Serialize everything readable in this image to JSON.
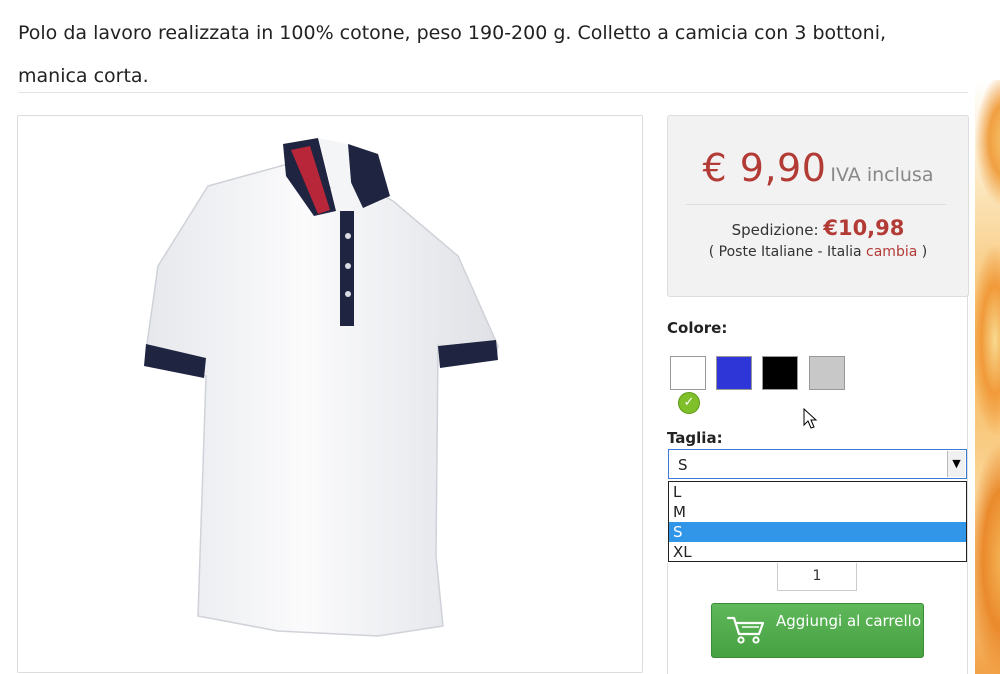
{
  "product": {
    "description": "Polo da lavoro realizzata in 100% cotone, peso 190-200 g. Colletto a camicia con 3 bottoni, manica corta."
  },
  "pricing": {
    "price": "€ 9,90",
    "vat_note": "IVA inclusa",
    "shipping_label": "Spedizione:",
    "shipping_value": "€10,98",
    "carrier_prefix": "( Poste Italiane - Italia",
    "change_link": "cambia",
    "carrier_suffix": ")"
  },
  "color": {
    "label": "Colore:",
    "swatches": [
      {
        "name": "white",
        "hex": "#ffffff",
        "selected": true
      },
      {
        "name": "royal-blue",
        "hex": "#2f36d8",
        "selected": false
      },
      {
        "name": "black",
        "hex": "#000000",
        "selected": false
      },
      {
        "name": "grey",
        "hex": "#c8c8c8",
        "selected": false
      }
    ]
  },
  "size": {
    "label": "Taglia:",
    "selected": "S",
    "options": [
      "L",
      "M",
      "S",
      "XL"
    ]
  },
  "quantity": {
    "value": "1"
  },
  "cart": {
    "button_label": "Aggiungi al carrello"
  },
  "colors": {
    "accent_red": "#b33b36",
    "button_green": "#4caa47",
    "select_highlight": "#3296e8"
  }
}
